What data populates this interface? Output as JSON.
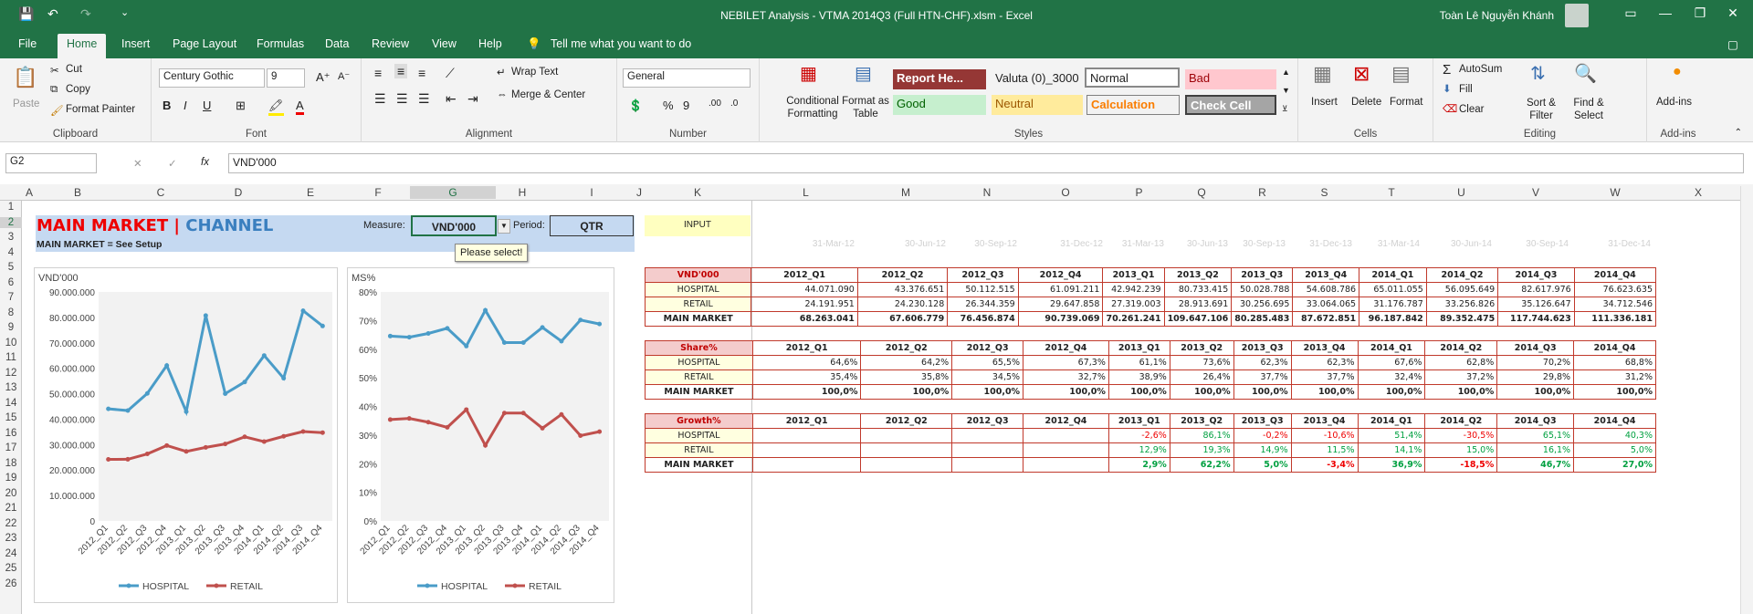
{
  "window": {
    "title": "NEBILET Analysis - VTMA 2014Q3 (Full HTN-CHF).xlsm  -  Excel",
    "user": "Toàn  Lê Nguyễn Khánh"
  },
  "tabs": [
    "File",
    "Home",
    "Insert",
    "Page Layout",
    "Formulas",
    "Data",
    "Review",
    "View",
    "Help",
    "Tell me what you want to do"
  ],
  "ribbon": {
    "clipboard": {
      "paste": "Paste",
      "cut": "Cut",
      "copy": "Copy",
      "painter": "Format Painter",
      "label": "Clipboard"
    },
    "font": {
      "name": "Century Gothic",
      "size": "9",
      "label": "Font"
    },
    "alignment": {
      "wrap": "Wrap Text",
      "merge": "Merge & Center",
      "label": "Alignment"
    },
    "number": {
      "format": "General",
      "label": "Number"
    },
    "styles": {
      "cond": "Conditional Formatting",
      "table": "Format as Table",
      "label": "Styles",
      "cells": [
        "Report He...",
        "Valuta (0)_3000",
        "Normal",
        "Bad",
        "Good",
        "Neutral",
        "Calculation",
        "Check Cell"
      ]
    },
    "cells": {
      "insert": "Insert",
      "delete": "Delete",
      "format": "Format",
      "label": "Cells"
    },
    "editing": {
      "autosum": "AutoSum",
      "fill": "Fill",
      "clear": "Clear",
      "sort": "Sort & Filter",
      "find": "Find & Select",
      "label": "Editing"
    },
    "addins": {
      "btn": "Add-ins",
      "label": "Add-ins"
    }
  },
  "formula_bar": {
    "name_box": "G2",
    "value": "VND'000",
    "fx": "fx"
  },
  "columns": [
    "A",
    "B",
    "C",
    "D",
    "E",
    "F",
    "G",
    "H",
    "I",
    "J",
    "K",
    "L",
    "M",
    "N",
    "O",
    "P",
    "Q",
    "R",
    "S",
    "T",
    "U",
    "V",
    "W",
    "X"
  ],
  "rows": [
    "1",
    "2",
    "3",
    "4",
    "5",
    "6",
    "7",
    "8",
    "9",
    "10",
    "11",
    "12",
    "13",
    "14",
    "15",
    "16",
    "17",
    "18",
    "19",
    "20",
    "21",
    "22",
    "23",
    "24",
    "25",
    "26"
  ],
  "sheet": {
    "title_main": "MAIN MARKET",
    "title_sep": "|",
    "title_channel": "CHANNEL",
    "subtitle": "MAIN MARKET = See Setup",
    "measure_label": "Measure:",
    "measure_value": "VND'000",
    "period_label": "Period:",
    "period_value": "QTR",
    "input": "INPUT",
    "tooltip": "Please select!",
    "dates": [
      "31-Mar-12",
      "30-Jun-12",
      "30-Sep-12",
      "31-Dec-12",
      "31-Mar-13",
      "30-Jun-13",
      "30-Sep-13",
      "31-Dec-13",
      "31-Mar-14",
      "30-Jun-14",
      "30-Sep-14",
      "31-Dec-14"
    ]
  },
  "tables": {
    "quarters": [
      "2012_Q1",
      "2012_Q2",
      "2012_Q3",
      "2012_Q4",
      "2013_Q1",
      "2013_Q2",
      "2013_Q3",
      "2013_Q4",
      "2014_Q1",
      "2014_Q2",
      "2014_Q3",
      "2014_Q4"
    ],
    "vnd": {
      "header": "VND'000",
      "rows": [
        {
          "label": "HOSPITAL",
          "values": [
            "44.071.090",
            "43.376.651",
            "50.112.515",
            "61.091.211",
            "42.942.239",
            "80.733.415",
            "50.028.788",
            "54.608.786",
            "65.011.055",
            "56.095.649",
            "82.617.976",
            "76.623.635"
          ]
        },
        {
          "label": "RETAIL",
          "values": [
            "24.191.951",
            "24.230.128",
            "26.344.359",
            "29.647.858",
            "27.319.003",
            "28.913.691",
            "30.256.695",
            "33.064.065",
            "31.176.787",
            "33.256.826",
            "35.126.647",
            "34.712.546"
          ]
        },
        {
          "label": "MAIN MARKET",
          "values": [
            "68.263.041",
            "67.606.779",
            "76.456.874",
            "90.739.069",
            "70.261.241",
            "109.647.106",
            "80.285.483",
            "87.672.851",
            "96.187.842",
            "89.352.475",
            "117.744.623",
            "111.336.181"
          ]
        }
      ]
    },
    "share": {
      "header": "Share%",
      "rows": [
        {
          "label": "HOSPITAL",
          "values": [
            "64,6%",
            "64,2%",
            "65,5%",
            "67,3%",
            "61,1%",
            "73,6%",
            "62,3%",
            "62,3%",
            "67,6%",
            "62,8%",
            "70,2%",
            "68,8%"
          ]
        },
        {
          "label": "RETAIL",
          "values": [
            "35,4%",
            "35,8%",
            "34,5%",
            "32,7%",
            "38,9%",
            "26,4%",
            "37,7%",
            "37,7%",
            "32,4%",
            "37,2%",
            "29,8%",
            "31,2%"
          ]
        },
        {
          "label": "MAIN MARKET",
          "values": [
            "100,0%",
            "100,0%",
            "100,0%",
            "100,0%",
            "100,0%",
            "100,0%",
            "100,0%",
            "100,0%",
            "100,0%",
            "100,0%",
            "100,0%",
            "100,0%"
          ]
        }
      ]
    },
    "growth": {
      "header": "Growth%",
      "rows": [
        {
          "label": "HOSPITAL",
          "values": [
            "",
            "",
            "",
            "",
            "-2,6%",
            "86,1%",
            "-0,2%",
            "-10,6%",
            "51,4%",
            "-30,5%",
            "65,1%",
            "40,3%"
          ]
        },
        {
          "label": "RETAIL",
          "values": [
            "",
            "",
            "",
            "",
            "12,9%",
            "19,3%",
            "14,9%",
            "11,5%",
            "14,1%",
            "15,0%",
            "16,1%",
            "5,0%"
          ]
        },
        {
          "label": "MAIN MARKET",
          "values": [
            "",
            "",
            "",
            "",
            "2,9%",
            "62,2%",
            "5,0%",
            "-3,4%",
            "36,9%",
            "-18,5%",
            "46,7%",
            "27,0%"
          ]
        }
      ]
    }
  },
  "chart_data": [
    {
      "type": "line",
      "ylabel": "VND'000",
      "ylim": [
        0,
        90000000
      ],
      "yticks": [
        "0",
        "10.000.000",
        "20.000.000",
        "30.000.000",
        "40.000.000",
        "50.000.000",
        "60.000.000",
        "70.000.000",
        "80.000.000",
        "90.000.000"
      ],
      "categories": [
        "2012_Q1",
        "2012_Q2",
        "2012_Q3",
        "2012_Q4",
        "2013_Q1",
        "2013_Q2",
        "2013_Q3",
        "2013_Q4",
        "2014_Q1",
        "2014_Q2",
        "2014_Q3",
        "2014_Q4"
      ],
      "series": [
        {
          "name": "HOSPITAL",
          "color": "#4a9cc8",
          "values": [
            44071090,
            43376651,
            50112515,
            61091211,
            42942239,
            80733415,
            50028788,
            54608786,
            65011055,
            56095649,
            82617976,
            76623635
          ]
        },
        {
          "name": "RETAIL",
          "color": "#c0504d",
          "values": [
            24191951,
            24230128,
            26344359,
            29647858,
            27319003,
            28913691,
            30256695,
            33064065,
            31176787,
            33256826,
            35126647,
            34712546
          ]
        }
      ],
      "legend": "bottom"
    },
    {
      "type": "line",
      "ylabel": "MS%",
      "ylim": [
        0,
        80
      ],
      "yticks": [
        "0%",
        "10%",
        "20%",
        "30%",
        "40%",
        "50%",
        "60%",
        "70%",
        "80%"
      ],
      "categories": [
        "2012_Q1",
        "2012_Q2",
        "2012_Q3",
        "2012_Q4",
        "2013_Q1",
        "2013_Q2",
        "2013_Q3",
        "2013_Q4",
        "2014_Q1",
        "2014_Q2",
        "2014_Q3",
        "2014_Q4"
      ],
      "series": [
        {
          "name": "HOSPITAL",
          "color": "#4a9cc8",
          "values": [
            64.6,
            64.2,
            65.5,
            67.3,
            61.1,
            73.6,
            62.3,
            62.3,
            67.6,
            62.8,
            70.2,
            68.8
          ]
        },
        {
          "name": "RETAIL",
          "color": "#c0504d",
          "values": [
            35.4,
            35.8,
            34.5,
            32.7,
            38.9,
            26.4,
            37.7,
            37.7,
            32.4,
            37.2,
            29.8,
            31.2
          ]
        }
      ],
      "legend": "bottom"
    }
  ]
}
